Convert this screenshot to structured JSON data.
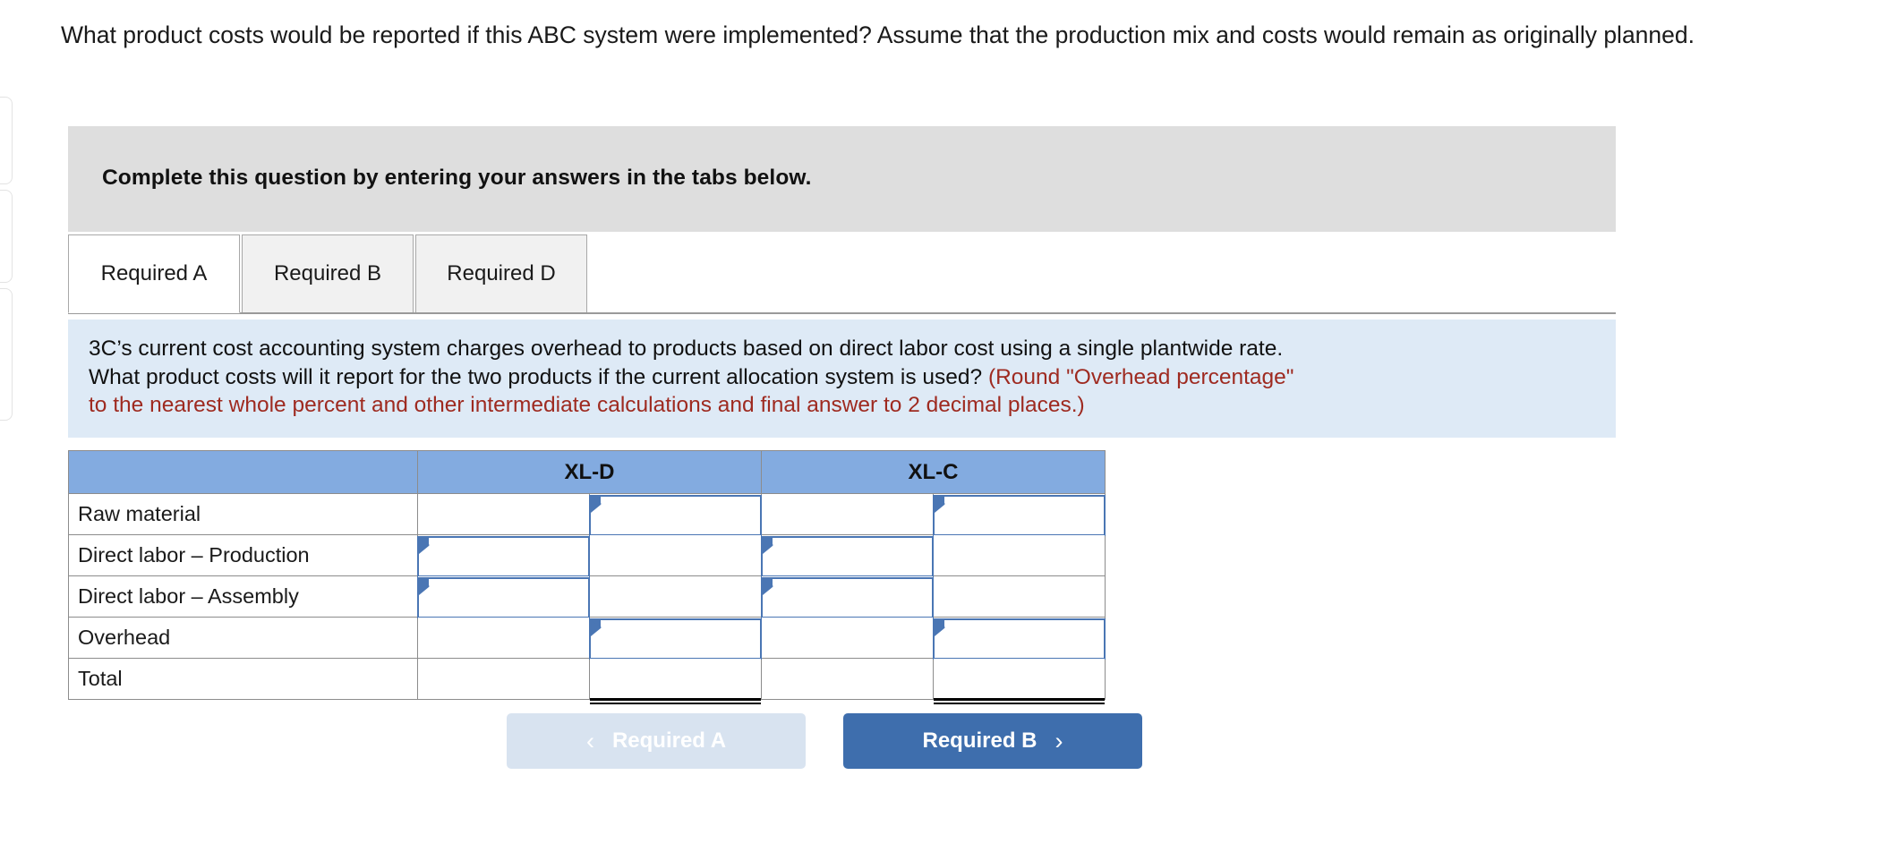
{
  "question": {
    "text": "What product costs would be reported if this ABC system were implemented? Assume that the production mix and costs would remain as originally planned."
  },
  "banner": {
    "text": "Complete this question by entering your answers in the tabs below."
  },
  "tabs": {
    "items": [
      {
        "label": "Required A",
        "active": true
      },
      {
        "label": "Required B",
        "active": false
      },
      {
        "label": "Required D",
        "active": false
      }
    ]
  },
  "info_panel": {
    "line1": "3C’s current cost accounting system charges overhead to products based on direct labor cost using a single plantwide rate.",
    "line2_black": "What product costs will it report for the two products if the current allocation system is used? ",
    "line2_red": "(Round \"Overhead percentage\"",
    "line3_red": "to the nearest whole percent and other intermediate calculations and final answer to 2 decimal places.)"
  },
  "table": {
    "corner_header": "",
    "column_headers": [
      "XL-D",
      "XL-C"
    ],
    "rows": [
      {
        "label": "Raw material",
        "values": [
          "",
          "",
          "",
          ""
        ]
      },
      {
        "label": "Direct labor – Production",
        "values": [
          "",
          "",
          "",
          ""
        ]
      },
      {
        "label": "Direct labor – Assembly",
        "values": [
          "",
          "",
          "",
          ""
        ]
      },
      {
        "label": "Overhead",
        "values": [
          "",
          "",
          "",
          ""
        ]
      },
      {
        "label": "Total",
        "values": [
          "",
          "",
          "",
          ""
        ]
      }
    ]
  },
  "nav": {
    "prev_label": "Required A",
    "prev_icon": "chevron-left-icon",
    "next_label": "Required B",
    "next_icon": "chevron-right-icon"
  },
  "colors": {
    "header_blue": "#83abe0",
    "info_panel_blue": "#deeaf6",
    "banner_grey": "#dedede",
    "accent_red": "#9e2a20",
    "button_blue": "#3e6ead",
    "button_disabled": "#d8e3f0",
    "entry_border": "#4a76b4"
  }
}
